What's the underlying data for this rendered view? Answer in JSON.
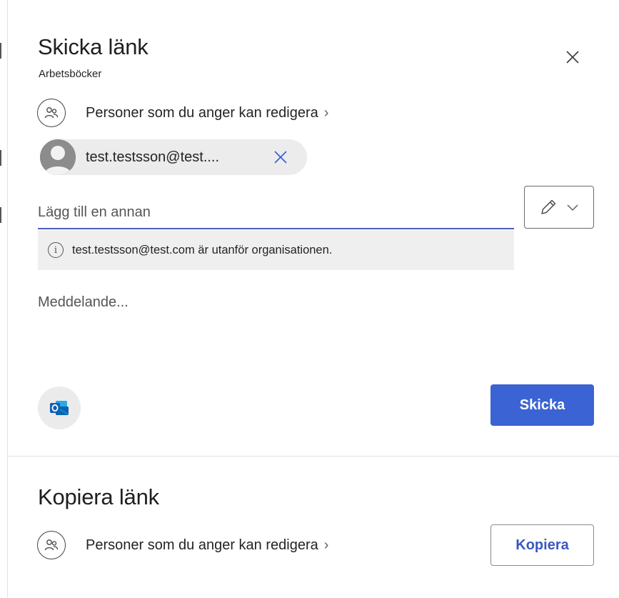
{
  "send_section": {
    "title": "Skicka länk",
    "subtitle": "Arbetsböcker",
    "permission_text": "Personer som du anger kan redigera",
    "permission_chevron": "›",
    "recipient_chip": "test.testsson@test....",
    "add_placeholder": "Lägg till en annan",
    "info_message": "test.testsson@test.com är utanför organisationen.",
    "message_placeholder": "Meddelande...",
    "send_label": "Skicka"
  },
  "copy_section": {
    "title": "Kopiera länk",
    "permission_text": "Personer som du anger kan redigera",
    "permission_chevron": "›",
    "copy_label": "Kopiera"
  },
  "icons": {
    "close": "close-icon",
    "people": "people-icon",
    "remove": "close-icon",
    "edit": "pencil-icon",
    "dropdown": "chevron-down-icon",
    "info": "info-icon",
    "outlook": "outlook-icon"
  },
  "colors": {
    "primary": "#3b63d3",
    "link_text": "#3b57c4",
    "input_underline": "#4a5fbd",
    "remove_x": "#3b63d3"
  }
}
